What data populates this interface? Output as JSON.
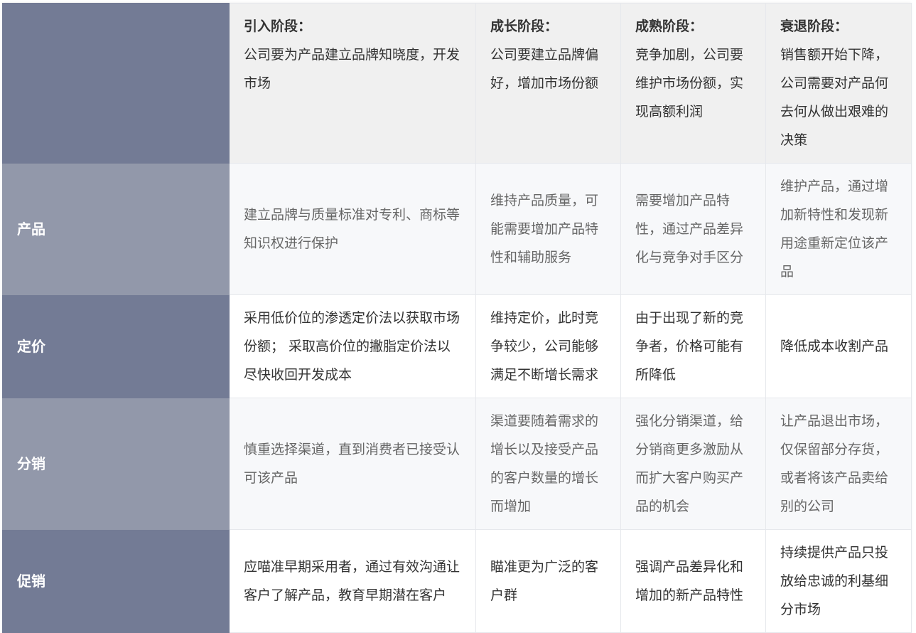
{
  "header": {
    "stages": [
      {
        "title": "引入阶段：",
        "desc": "公司要为产品建立品牌知晓度，开发市场"
      },
      {
        "title": "成长阶段：",
        "desc": "公司要建立品牌偏好，增加市场份额"
      },
      {
        "title": "成熟阶段：",
        "desc": "竞争加剧，公司要维护市场份额，实现高额利润"
      },
      {
        "title": "衰退阶段：",
        "desc": "销售额开始下降，公司需要对产品何去何从做出艰难的决策"
      }
    ]
  },
  "rows": [
    {
      "label": "产品",
      "cells": [
        "建立品牌与质量标准对专利、商标等知识权进行保护",
        "维持产品质量，可能需要增加产品特性和辅助服务",
        "需要增加产品特性，通过产品差异化与竞争对手区分",
        "维护产品，通过增加新特性和发现新用途重新定位该产品"
      ]
    },
    {
      "label": "定价",
      "cells": [
        "采用低价位的渗透定价法以获取市场份额； 采取高价位的撇脂定价法以尽快收回开发成本",
        "维持定价，此时竞争较少，公司能够满足不断增长需求",
        "由于出现了新的竞争者，价格可能有所降低",
        "降低成本收割产品"
      ]
    },
    {
      "label": "分销",
      "cells": [
        "慎重选择渠道，直到消费者已接受认可该产品",
        "渠道要随着需求的增长以及接受产品的客户数量的增长而增加",
        "强化分销渠道，给分销商更多激励从而扩大客户购买产品的机会",
        "让产品退出市场，仅保留部分存货，或者将该产品卖给别的公司"
      ]
    },
    {
      "label": "促销",
      "cells": [
        "应喵准早期采用者，通过有效沟通让客户了解产品，教育早期潜在客户",
        "瞄准更为广泛的客户群",
        "强调产品差异化和增加的新产品特性",
        "持续提供产品只投放给忠诚的利基细分市场"
      ]
    }
  ],
  "colors": {
    "rowhead_dark": "#737b95",
    "rowhead_light": "#9298aa",
    "header_bg": "#f0f0f0",
    "alt_row_bg": "#f7f8fa"
  }
}
